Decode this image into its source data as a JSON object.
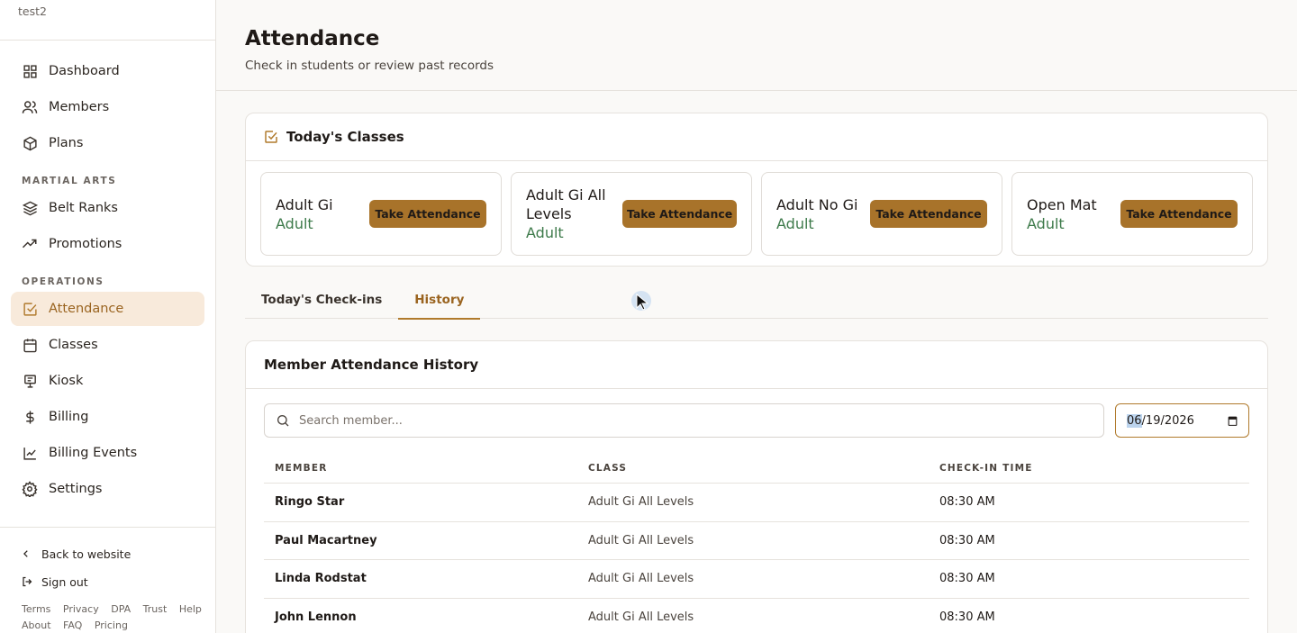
{
  "sidebar": {
    "org_name": "test2",
    "items_main": [
      {
        "label": "Dashboard",
        "icon": "dashboard-icon"
      },
      {
        "label": "Members",
        "icon": "members-icon"
      },
      {
        "label": "Plans",
        "icon": "box-icon"
      }
    ],
    "section_martial_arts": "MARTIAL ARTS",
    "items_martial": [
      {
        "label": "Belt Ranks",
        "icon": "layers-icon"
      },
      {
        "label": "Promotions",
        "icon": "trending-up-icon"
      }
    ],
    "section_operations": "OPERATIONS",
    "items_ops": [
      {
        "label": "Attendance",
        "icon": "check-square-icon",
        "active": true
      },
      {
        "label": "Classes",
        "icon": "calendar-icon"
      },
      {
        "label": "Kiosk",
        "icon": "kiosk-icon"
      },
      {
        "label": "Billing",
        "icon": "dollar-icon"
      },
      {
        "label": "Billing Events",
        "icon": "chart-icon"
      },
      {
        "label": "Settings",
        "icon": "gear-icon"
      }
    ],
    "back_label": "Back to website",
    "signout_label": "Sign out",
    "legal_row1": [
      "Terms",
      "Privacy",
      "DPA",
      "Trust",
      "Help"
    ],
    "legal_row2": [
      "About",
      "FAQ",
      "Pricing"
    ]
  },
  "header": {
    "title": "Attendance",
    "subtitle": "Check in students or review past records"
  },
  "today": {
    "title": "Today's Classes",
    "classes": [
      {
        "name": "Adult Gi",
        "level": "Adult",
        "button": "Take Attendance"
      },
      {
        "name": "Adult Gi All Levels",
        "level": "Adult",
        "button": "Take Attendance"
      },
      {
        "name": "Adult No Gi",
        "level": "Adult",
        "button": "Take Attendance"
      },
      {
        "name": "Open Mat",
        "level": "Adult",
        "button": "Take Attendance"
      }
    ]
  },
  "tabs": [
    {
      "label": "Today's Check-ins",
      "active": false
    },
    {
      "label": "History",
      "active": true
    }
  ],
  "history": {
    "title": "Member Attendance History",
    "search_placeholder": "Search member...",
    "date_month": "06",
    "date_rest": "/19/2026",
    "columns": [
      "MEMBER",
      "CLASS",
      "CHECK-IN TIME"
    ],
    "rows": [
      {
        "member": "Ringo Star",
        "class": "Adult Gi All Levels",
        "time": "08:30 AM"
      },
      {
        "member": "Paul Macartney",
        "class": "Adult Gi All Levels",
        "time": "08:30 AM"
      },
      {
        "member": "Linda Rodstat",
        "class": "Adult Gi All Levels",
        "time": "08:30 AM"
      },
      {
        "member": "John Lennon",
        "class": "Adult Gi All Levels",
        "time": "08:30 AM"
      }
    ]
  },
  "colors": {
    "accent": "#b07a2c",
    "button_bg": "#a8732a",
    "active_nav_bg": "#f8eadb",
    "level_green": "#3d7a4a"
  }
}
